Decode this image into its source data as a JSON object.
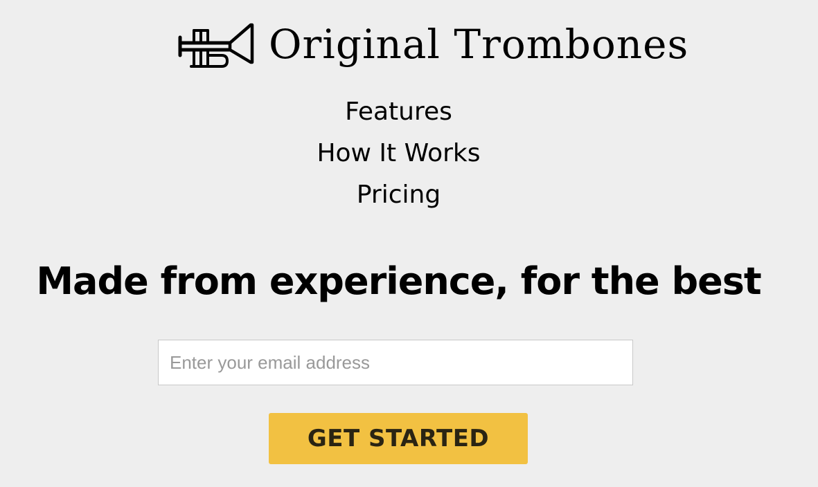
{
  "header": {
    "logo_icon": "trumpet-icon",
    "brand_name": "Original Trombones"
  },
  "nav": {
    "items": [
      {
        "label": "Features"
      },
      {
        "label": "How It Works"
      },
      {
        "label": "Pricing"
      }
    ]
  },
  "hero": {
    "headline": "Made from experience, for the best"
  },
  "signup": {
    "email_value": "",
    "email_placeholder": "Enter your email address",
    "submit_label": "GET STARTED"
  },
  "colors": {
    "page_background": "#eeeeee",
    "cta_background": "#f2c142",
    "cta_text": "#2a2413",
    "input_border": "#c8c8c8",
    "placeholder_text": "#999999"
  }
}
